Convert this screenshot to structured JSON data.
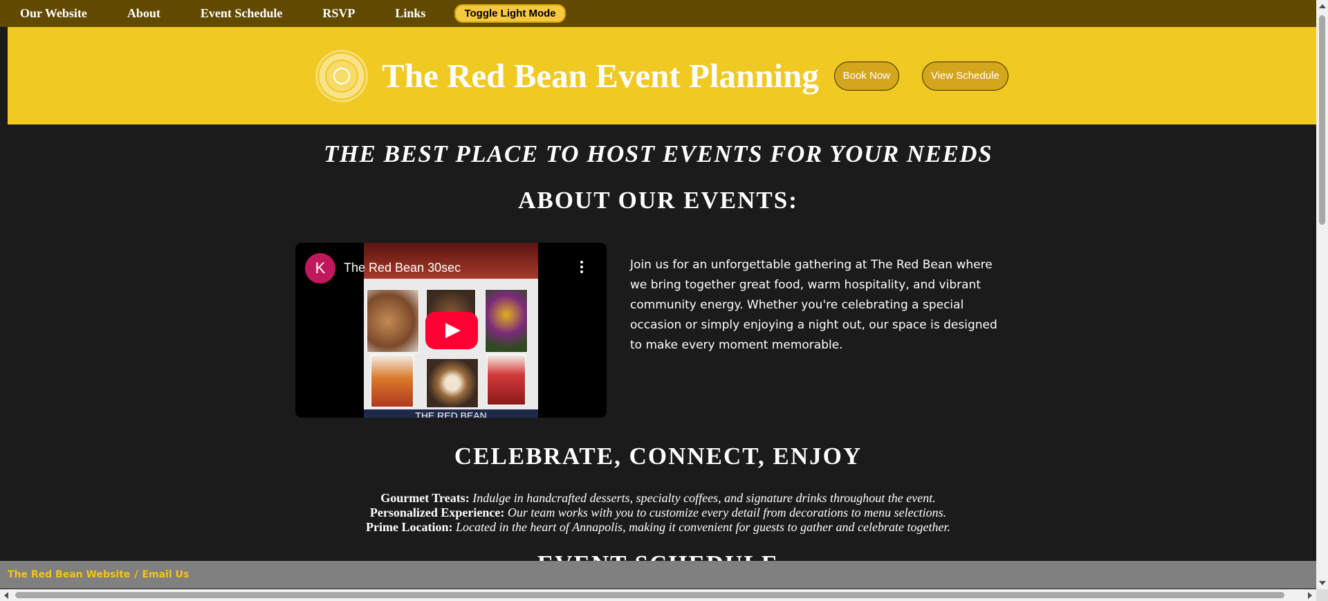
{
  "nav": {
    "items": [
      {
        "label": "Our Website"
      },
      {
        "label": "About"
      },
      {
        "label": "Event Schedule"
      },
      {
        "label": "RSVP"
      },
      {
        "label": "Links"
      }
    ],
    "toggle_label": "Toggle Light Mode"
  },
  "header": {
    "title": "The Red Bean Event Planning",
    "book_label": "Book Now",
    "schedule_label": "View Schedule",
    "logo_icon": "red-bean-logo"
  },
  "main": {
    "tagline": "THE BEST PLACE TO HOST EVENTS FOR YOUR NEEDS",
    "about_heading": "ABOUT OUR EVENTS:",
    "video": {
      "channel_initial": "K",
      "title": "The Red Bean 30sec",
      "thumb_footer": "THE RED BEAN"
    },
    "about_text": "Join us for an unforgettable gathering at The Red Bean where we bring together great food, warm hospitality, and vibrant community energy. Whether you're celebrating a special occasion or simply enjoying a night out, our space is designed to make every moment memorable.",
    "celebrate_heading": "CELEBRATE, CONNECT, ENJOY",
    "features": [
      {
        "label": "Gourmet Treats:",
        "text": "Indulge in handcrafted desserts, specialty coffees, and signature drinks throughout the event."
      },
      {
        "label": "Personalized Experience:",
        "text": "Our team works with you to customize every detail from decorations to menu selections."
      },
      {
        "label": "Prime Location:",
        "text": "Located in the heart of Annapolis, making it convenient for guests to gather and celebrate together."
      }
    ],
    "schedule_heading": "EVENT SCHEDULE"
  },
  "footer": {
    "website_link": "The Red Bean Website",
    "separator": "/",
    "email_link": "Email Us"
  },
  "colors": {
    "nav_bg": "#614900",
    "banner_bg": "#f0c922",
    "page_bg": "#1b1b1b",
    "accent_button": "#d4a61e",
    "footer_bg": "#808080",
    "footer_link": "#f5c518",
    "play_button": "#ff0033"
  }
}
